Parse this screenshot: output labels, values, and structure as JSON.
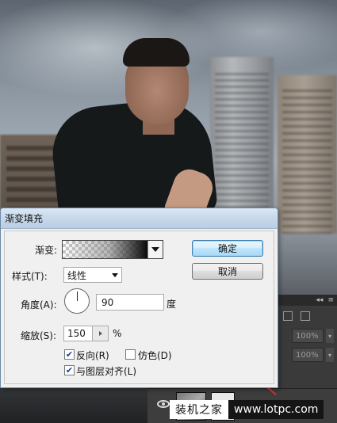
{
  "dialog": {
    "title": "渐变填充",
    "gradient_label": "渐变:",
    "style_label": "样式(T):",
    "style_value": "线性",
    "angle_label": "角度(A):",
    "angle_value": "90",
    "angle_unit": "度",
    "scale_label": "缩放(S):",
    "scale_value": "150",
    "scale_unit": "%",
    "reverse_label": "反向(R)",
    "reverse_checked": true,
    "dither_label": "仿色(D)",
    "dither_checked": false,
    "align_label": "与图层对齐(L)",
    "align_checked": true,
    "ok_label": "确定",
    "cancel_label": "取消"
  },
  "layers_panel": {
    "opacity_value": "100%",
    "fill_value": "100%",
    "collapse_glyph": "◂◂"
  },
  "watermark": {
    "left_text": "装机之家",
    "right_text": "www.lotpc.com"
  },
  "colors": {
    "annotation_arrow": "#d9332b",
    "dialog_titlebar": "#c7d8ea",
    "primary_button": "#bee6fd"
  }
}
